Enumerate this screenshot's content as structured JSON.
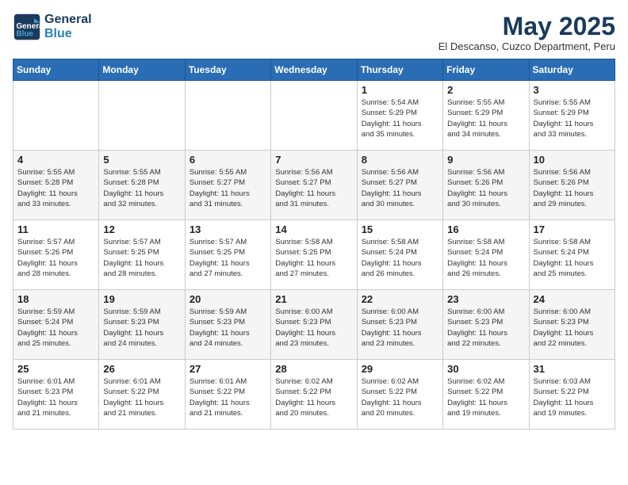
{
  "header": {
    "logo_line1": "General",
    "logo_line2": "Blue",
    "month_title": "May 2025",
    "location": "El Descanso, Cuzco Department, Peru"
  },
  "weekdays": [
    "Sunday",
    "Monday",
    "Tuesday",
    "Wednesday",
    "Thursday",
    "Friday",
    "Saturday"
  ],
  "weeks": [
    [
      {
        "day": "",
        "info": ""
      },
      {
        "day": "",
        "info": ""
      },
      {
        "day": "",
        "info": ""
      },
      {
        "day": "",
        "info": ""
      },
      {
        "day": "1",
        "info": "Sunrise: 5:54 AM\nSunset: 5:29 PM\nDaylight: 11 hours\nand 35 minutes."
      },
      {
        "day": "2",
        "info": "Sunrise: 5:55 AM\nSunset: 5:29 PM\nDaylight: 11 hours\nand 34 minutes."
      },
      {
        "day": "3",
        "info": "Sunrise: 5:55 AM\nSunset: 5:29 PM\nDaylight: 11 hours\nand 33 minutes."
      }
    ],
    [
      {
        "day": "4",
        "info": "Sunrise: 5:55 AM\nSunset: 5:28 PM\nDaylight: 11 hours\nand 33 minutes."
      },
      {
        "day": "5",
        "info": "Sunrise: 5:55 AM\nSunset: 5:28 PM\nDaylight: 11 hours\nand 32 minutes."
      },
      {
        "day": "6",
        "info": "Sunrise: 5:55 AM\nSunset: 5:27 PM\nDaylight: 11 hours\nand 31 minutes."
      },
      {
        "day": "7",
        "info": "Sunrise: 5:56 AM\nSunset: 5:27 PM\nDaylight: 11 hours\nand 31 minutes."
      },
      {
        "day": "8",
        "info": "Sunrise: 5:56 AM\nSunset: 5:27 PM\nDaylight: 11 hours\nand 30 minutes."
      },
      {
        "day": "9",
        "info": "Sunrise: 5:56 AM\nSunset: 5:26 PM\nDaylight: 11 hours\nand 30 minutes."
      },
      {
        "day": "10",
        "info": "Sunrise: 5:56 AM\nSunset: 5:26 PM\nDaylight: 11 hours\nand 29 minutes."
      }
    ],
    [
      {
        "day": "11",
        "info": "Sunrise: 5:57 AM\nSunset: 5:26 PM\nDaylight: 11 hours\nand 28 minutes."
      },
      {
        "day": "12",
        "info": "Sunrise: 5:57 AM\nSunset: 5:25 PM\nDaylight: 11 hours\nand 28 minutes."
      },
      {
        "day": "13",
        "info": "Sunrise: 5:57 AM\nSunset: 5:25 PM\nDaylight: 11 hours\nand 27 minutes."
      },
      {
        "day": "14",
        "info": "Sunrise: 5:58 AM\nSunset: 5:25 PM\nDaylight: 11 hours\nand 27 minutes."
      },
      {
        "day": "15",
        "info": "Sunrise: 5:58 AM\nSunset: 5:24 PM\nDaylight: 11 hours\nand 26 minutes."
      },
      {
        "day": "16",
        "info": "Sunrise: 5:58 AM\nSunset: 5:24 PM\nDaylight: 11 hours\nand 26 minutes."
      },
      {
        "day": "17",
        "info": "Sunrise: 5:58 AM\nSunset: 5:24 PM\nDaylight: 11 hours\nand 25 minutes."
      }
    ],
    [
      {
        "day": "18",
        "info": "Sunrise: 5:59 AM\nSunset: 5:24 PM\nDaylight: 11 hours\nand 25 minutes."
      },
      {
        "day": "19",
        "info": "Sunrise: 5:59 AM\nSunset: 5:23 PM\nDaylight: 11 hours\nand 24 minutes."
      },
      {
        "day": "20",
        "info": "Sunrise: 5:59 AM\nSunset: 5:23 PM\nDaylight: 11 hours\nand 24 minutes."
      },
      {
        "day": "21",
        "info": "Sunrise: 6:00 AM\nSunset: 5:23 PM\nDaylight: 11 hours\nand 23 minutes."
      },
      {
        "day": "22",
        "info": "Sunrise: 6:00 AM\nSunset: 5:23 PM\nDaylight: 11 hours\nand 23 minutes."
      },
      {
        "day": "23",
        "info": "Sunrise: 6:00 AM\nSunset: 5:23 PM\nDaylight: 11 hours\nand 22 minutes."
      },
      {
        "day": "24",
        "info": "Sunrise: 6:00 AM\nSunset: 5:23 PM\nDaylight: 11 hours\nand 22 minutes."
      }
    ],
    [
      {
        "day": "25",
        "info": "Sunrise: 6:01 AM\nSunset: 5:23 PM\nDaylight: 11 hours\nand 21 minutes."
      },
      {
        "day": "26",
        "info": "Sunrise: 6:01 AM\nSunset: 5:22 PM\nDaylight: 11 hours\nand 21 minutes."
      },
      {
        "day": "27",
        "info": "Sunrise: 6:01 AM\nSunset: 5:22 PM\nDaylight: 11 hours\nand 21 minutes."
      },
      {
        "day": "28",
        "info": "Sunrise: 6:02 AM\nSunset: 5:22 PM\nDaylight: 11 hours\nand 20 minutes."
      },
      {
        "day": "29",
        "info": "Sunrise: 6:02 AM\nSunset: 5:22 PM\nDaylight: 11 hours\nand 20 minutes."
      },
      {
        "day": "30",
        "info": "Sunrise: 6:02 AM\nSunset: 5:22 PM\nDaylight: 11 hours\nand 19 minutes."
      },
      {
        "day": "31",
        "info": "Sunrise: 6:03 AM\nSunset: 5:22 PM\nDaylight: 11 hours\nand 19 minutes."
      }
    ]
  ]
}
